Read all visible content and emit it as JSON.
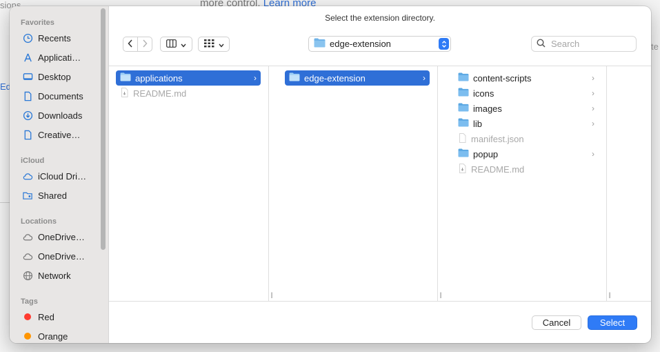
{
  "background": {
    "left_text": "sions",
    "top_text": "more control.",
    "top_link": "Learn more",
    "edge_text": "Ed",
    "right_text": "te"
  },
  "dialog": {
    "title": "Select the extension directory.",
    "path_popup": "edge-extension",
    "search_placeholder": "Search",
    "buttons": {
      "cancel": "Cancel",
      "select": "Select"
    }
  },
  "sidebar": {
    "favorites_title": "Favorites",
    "favorites": [
      {
        "label": "Recents",
        "icon": "clock-icon"
      },
      {
        "label": "Applicati…",
        "icon": "applications-icon"
      },
      {
        "label": "Desktop",
        "icon": "desktop-icon"
      },
      {
        "label": "Documents",
        "icon": "document-icon"
      },
      {
        "label": "Downloads",
        "icon": "download-icon"
      },
      {
        "label": "Creative…",
        "icon": "document-icon"
      }
    ],
    "icloud_title": "iCloud",
    "icloud": [
      {
        "label": "iCloud Dri…",
        "icon": "cloud-icon"
      },
      {
        "label": "Shared",
        "icon": "shared-folder-icon"
      }
    ],
    "locations_title": "Locations",
    "locations": [
      {
        "label": "OneDrive…",
        "icon": "cloud-icon"
      },
      {
        "label": "OneDrive…",
        "icon": "cloud-icon"
      },
      {
        "label": "Network",
        "icon": "globe-icon"
      }
    ],
    "tags_title": "Tags",
    "tags": [
      {
        "label": "Red",
        "color": "#ff3b30"
      },
      {
        "label": "Orange",
        "color": "#ff9500"
      }
    ]
  },
  "columns": [
    {
      "items": [
        {
          "name": "applications",
          "type": "folder",
          "selected": true
        },
        {
          "name": "README.md",
          "type": "file",
          "dim": true
        }
      ]
    },
    {
      "items": [
        {
          "name": "edge-extension",
          "type": "folder",
          "selected": true
        }
      ]
    },
    {
      "items": [
        {
          "name": "content-scripts",
          "type": "folder"
        },
        {
          "name": "icons",
          "type": "folder"
        },
        {
          "name": "images",
          "type": "folder"
        },
        {
          "name": "lib",
          "type": "folder"
        },
        {
          "name": "manifest.json",
          "type": "file",
          "dim": true
        },
        {
          "name": "popup",
          "type": "folder"
        },
        {
          "name": "README.md",
          "type": "file",
          "dim": true
        }
      ]
    }
  ],
  "colors": {
    "accent": "#2f7bf6",
    "selection": "#2f6fd7",
    "folder": "#6fb3e8"
  }
}
